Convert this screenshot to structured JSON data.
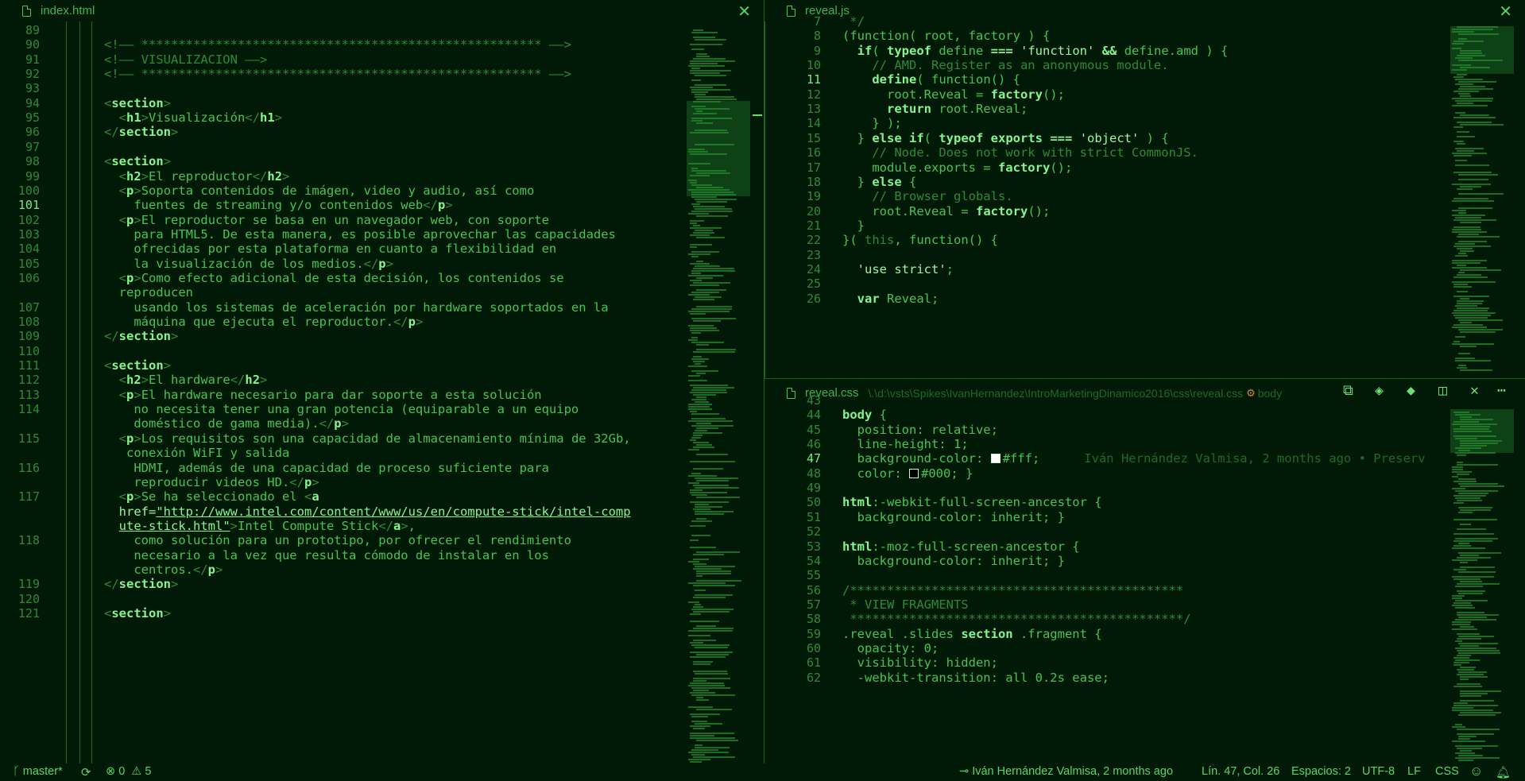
{
  "left_pane": {
    "tab_title": "index.html",
    "active_line": 101,
    "lines": [
      {
        "n": "89",
        "t": ""
      },
      {
        "n": "90",
        "t": "<span class=\"cmt\">&lt;!—— ****************************************************** ——&gt;</span>"
      },
      {
        "n": "91",
        "t": "<span class=\"cmt\">&lt;!—— VISUALIZACION ——&gt;</span>"
      },
      {
        "n": "92",
        "t": "<span class=\"cmt\">&lt;!—— ****************************************************** ——&gt;</span>"
      },
      {
        "n": "93",
        "t": ""
      },
      {
        "n": "94",
        "t": "<span class=\"brk\">&lt;</span><span class=\"tag\">section</span><span class=\"brk\">&gt;</span>"
      },
      {
        "n": "95",
        "t": "  <span class=\"brk\">&lt;</span><span class=\"tag\">h1</span><span class=\"brk\">&gt;</span>Visualización<span class=\"brk\">&lt;/</span><span class=\"tag\">h1</span><span class=\"brk\">&gt;</span>"
      },
      {
        "n": "96",
        "t": "<span class=\"brk\">&lt;/</span><span class=\"tag\">section</span><span class=\"brk\">&gt;</span>"
      },
      {
        "n": "97",
        "t": ""
      },
      {
        "n": "98",
        "t": "<span class=\"brk\">&lt;</span><span class=\"tag\">section</span><span class=\"brk\">&gt;</span>"
      },
      {
        "n": "99",
        "t": "  <span class=\"brk\">&lt;</span><span class=\"tag\">h2</span><span class=\"brk\">&gt;</span>El reproductor<span class=\"brk\">&lt;/</span><span class=\"tag\">h2</span><span class=\"brk\">&gt;</span>"
      },
      {
        "n": "100",
        "t": "  <span class=\"brk\">&lt;</span><span class=\"tag\">p</span><span class=\"brk\">&gt;</span>Soporta contenidos de imágen, video y audio, así como"
      },
      {
        "n": "101",
        "t": "    fuentes de streaming y/o contenidos web<span class=\"brk\">&lt;/</span><span class=\"tag\">p</span><span class=\"brk\">&gt;</span>"
      },
      {
        "n": "102",
        "t": "  <span class=\"brk\">&lt;</span><span class=\"tag\">p</span><span class=\"brk\">&gt;</span>El reproductor se basa en un navegador web, con soporte"
      },
      {
        "n": "103",
        "t": "    para HTML5. De esta manera, es posible aprovechar las capacidades"
      },
      {
        "n": "104",
        "t": "    ofrecidas por esta plataforma en cuanto a flexibilidad en"
      },
      {
        "n": "105",
        "t": "    la visualización de los medios.<span class=\"brk\">&lt;/</span><span class=\"tag\">p</span><span class=\"brk\">&gt;</span>"
      },
      {
        "n": "106",
        "t": "  <span class=\"brk\">&lt;</span><span class=\"tag\">p</span><span class=\"brk\">&gt;</span>Como efecto adicional de esta decisión, los contenidos se"
      },
      {
        "n": "",
        "t": "  reproducen"
      },
      {
        "n": "107",
        "t": "    usando los sistemas de aceleración por hardware soportados en la"
      },
      {
        "n": "108",
        "t": "    máquina que ejecuta el reproductor.<span class=\"brk\">&lt;/</span><span class=\"tag\">p</span><span class=\"brk\">&gt;</span>"
      },
      {
        "n": "109",
        "t": "<span class=\"brk\">&lt;/</span><span class=\"tag\">section</span><span class=\"brk\">&gt;</span>"
      },
      {
        "n": "110",
        "t": ""
      },
      {
        "n": "111",
        "t": "<span class=\"brk\">&lt;</span><span class=\"tag\">section</span><span class=\"brk\">&gt;</span>"
      },
      {
        "n": "112",
        "t": "  <span class=\"brk\">&lt;</span><span class=\"tag\">h2</span><span class=\"brk\">&gt;</span>El hardware<span class=\"brk\">&lt;/</span><span class=\"tag\">h2</span><span class=\"brk\">&gt;</span>"
      },
      {
        "n": "113",
        "t": "  <span class=\"brk\">&lt;</span><span class=\"tag\">p</span><span class=\"brk\">&gt;</span>El hardware necesario para dar soporte a esta solución"
      },
      {
        "n": "114",
        "t": "    no necesita tener una gran potencia (equiparable a un equipo"
      },
      {
        "n": "",
        "t": "    doméstico de gama media).<span class=\"brk\">&lt;/</span><span class=\"tag\">p</span><span class=\"brk\">&gt;</span>"
      },
      {
        "n": "115",
        "t": "  <span class=\"brk\">&lt;</span><span class=\"tag\">p</span><span class=\"brk\">&gt;</span>Los requisitos son una capacidad de almacenamiento mínima de 32Gb,"
      },
      {
        "n": "",
        "t": "   conexión WiFI y salida"
      },
      {
        "n": "116",
        "t": "    HDMI, además de una capacidad de proceso suficiente para"
      },
      {
        "n": "",
        "t": "    reproducir videos HD.<span class=\"brk\">&lt;/</span><span class=\"tag\">p</span><span class=\"brk\">&gt;</span>"
      },
      {
        "n": "117",
        "t": "  <span class=\"brk\">&lt;</span><span class=\"tag\">p</span><span class=\"brk\">&gt;</span>Se ha seleccionado el <span class=\"brk\">&lt;</span><span class=\"tag\">a</span>"
      },
      {
        "n": "",
        "t": "  <span class=\"str\">href=</span><span class=\"url\">\"http://www.intel.com/content/www/us/en/compute-stick/intel-comp</span>"
      },
      {
        "n": "",
        "t": "  <span class=\"url\">ute-stick.html\"</span><span class=\"brk\">&gt;</span>Intel Compute Stick<span class=\"brk\">&lt;/</span><span class=\"tag\">a</span><span class=\"brk\">&gt;</span>,"
      },
      {
        "n": "118",
        "t": "    como solución para un prototipo, por ofrecer el rendimiento"
      },
      {
        "n": "",
        "t": "    necesario a la vez que resulta cómodo de instalar en los"
      },
      {
        "n": "",
        "t": "    centros.<span class=\"brk\">&lt;/</span><span class=\"tag\">p</span><span class=\"brk\">&gt;</span>"
      },
      {
        "n": "119",
        "t": "<span class=\"brk\">&lt;/</span><span class=\"tag\">section</span><span class=\"brk\">&gt;</span>"
      },
      {
        "n": "120",
        "t": ""
      },
      {
        "n": "121",
        "t": "<span class=\"brk\">&lt;</span><span class=\"tag\">section</span><span class=\"brk\">&gt;</span>"
      }
    ]
  },
  "top_right_pane": {
    "tab_title": "reveal.js",
    "active_line": 11,
    "lines": [
      {
        "n": "7",
        "t": "<span class=\"cmt\"> */</span>"
      },
      {
        "n": "8",
        "t": "(function( root, factory ) {"
      },
      {
        "n": "9",
        "t": "  <span class=\"kw\">if</span>( <span class=\"kw\">typeof</span> define <span class=\"kw\">===</span> <span class=\"str\">'function'</span> <span class=\"kw\">&amp;&amp;</span> define.amd ) {"
      },
      {
        "n": "10",
        "t": "    <span class=\"cmt\">// AMD. Register as an anonymous module.</span>"
      },
      {
        "n": "11",
        "t": "    <span class=\"kw\">define</span>( function() {"
      },
      {
        "n": "12",
        "t": "      root.Reveal = <span class=\"kw\">factory</span>();"
      },
      {
        "n": "13",
        "t": "      <span class=\"kw\">return</span> root.Reveal;"
      },
      {
        "n": "14",
        "t": "    } );"
      },
      {
        "n": "15",
        "t": "  } <span class=\"kw\">else if</span>( <span class=\"kw\">typeof</span> <span class=\"kw\">exports</span> <span class=\"kw\">===</span> <span class=\"str\">'object'</span> ) {"
      },
      {
        "n": "16",
        "t": "    <span class=\"cmt\">// Node. Does not work with strict CommonJS.</span>"
      },
      {
        "n": "17",
        "t": "    module.exports = <span class=\"kw\">factory</span>();"
      },
      {
        "n": "18",
        "t": "  } <span class=\"kw\">else</span> {"
      },
      {
        "n": "19",
        "t": "    <span class=\"cmt\">// Browser globals.</span>"
      },
      {
        "n": "20",
        "t": "    root.Reveal = <span class=\"kw\">factory</span>();"
      },
      {
        "n": "21",
        "t": "  }"
      },
      {
        "n": "22",
        "t": "}( <span class=\"cmt\">this</span>, function() {"
      },
      {
        "n": "23",
        "t": ""
      },
      {
        "n": "24",
        "t": "  <span class=\"str\">'use strict'</span>;"
      },
      {
        "n": "25",
        "t": ""
      },
      {
        "n": "26",
        "t": "  <span class=\"kw\">var</span> Reveal;"
      }
    ]
  },
  "bottom_right_pane": {
    "tab_title": "reveal.css",
    "breadcrumb": "\\.\\d:\\vsts\\Spikes\\IvanHernandez\\IntroMarketingDinamico2016\\css\\reveal.css",
    "breadcrumb_symbol": "body",
    "active_line": 47,
    "blame": "Iván Hernández Valmisa, 2 months ago • Preserv",
    "lines": [
      {
        "n": "43",
        "t": ""
      },
      {
        "n": "44",
        "t": "<span class=\"kw\">body</span> {"
      },
      {
        "n": "45",
        "t": "  position: relative;"
      },
      {
        "n": "46",
        "t": "  line-height: 1;"
      },
      {
        "n": "47",
        "t": "  background-color: <span class=\"swatch\" style=\"background:#fff\"></span>#fff;"
      },
      {
        "n": "48",
        "t": "  color: <span class=\"swatch\" style=\"background:#000\"></span>#000; }"
      },
      {
        "n": "49",
        "t": ""
      },
      {
        "n": "50",
        "t": "<span class=\"kw\">html</span>:-webkit-full-screen-ancestor {"
      },
      {
        "n": "51",
        "t": "  background-color: inherit; }"
      },
      {
        "n": "52",
        "t": ""
      },
      {
        "n": "53",
        "t": "<span class=\"kw\">html</span>:-moz-full-screen-ancestor {"
      },
      {
        "n": "54",
        "t": "  background-color: inherit; }"
      },
      {
        "n": "55",
        "t": ""
      },
      {
        "n": "56",
        "t": "<span class=\"cmt\">/*********************************************</span>"
      },
      {
        "n": "57",
        "t": "<span class=\"cmt\"> * VIEW FRAGMENTS</span>"
      },
      {
        "n": "58",
        "t": "<span class=\"cmt\"> *********************************************/</span>"
      },
      {
        "n": "59",
        "t": ".reveal .slides <span class=\"kw\">section</span> .fragment {"
      },
      {
        "n": "60",
        "t": "  opacity: 0;"
      },
      {
        "n": "61",
        "t": "  visibility: hidden;"
      },
      {
        "n": "62",
        "t": "  -webkit-transition: all 0.2s ease;"
      }
    ]
  },
  "statusbar": {
    "branch": "master*",
    "sync_icon": "sync-icon",
    "errors": "0",
    "warnings": "5",
    "blame": "Iván Hernández Valmisa, 2 months ago",
    "position": "Lín. 47, Col. 26",
    "indent": "Espacios: 2",
    "encoding": "UTF-8",
    "eol": "LF",
    "language": "CSS"
  },
  "colors": {
    "background": "#011a07",
    "text": "#48c450",
    "keyword": "#87f58e",
    "comment": "#2f8a36"
  }
}
